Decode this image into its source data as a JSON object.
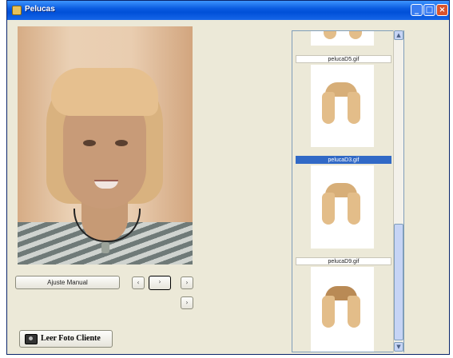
{
  "window": {
    "title": "Pelucas",
    "buttons": {
      "minimize": "_",
      "maximize": "□",
      "close": "×"
    }
  },
  "controls": {
    "ajuste_manual": "Ajuste Manual",
    "arrows": {
      "left": "‹",
      "center": "›",
      "right": "›",
      "down": "›"
    },
    "foto_button": "Leer Foto Cliente"
  },
  "wig_list": {
    "items": [
      {
        "label": "",
        "selected": false
      },
      {
        "label": "pelucaD5.gif",
        "selected": false
      },
      {
        "label": "pelucaD3.gif",
        "selected": true
      },
      {
        "label": "pelucaD9.gif",
        "selected": false
      }
    ]
  },
  "icons": {
    "camera": "camera-icon",
    "scroll_up": "▲",
    "scroll_down": "▼"
  }
}
